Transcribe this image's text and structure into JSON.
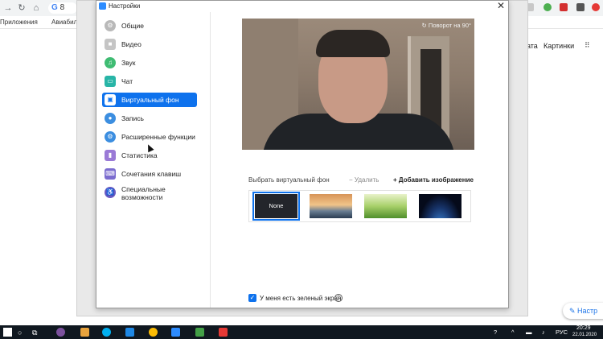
{
  "browser": {
    "address_fragment": "8",
    "bookmarks": [
      "Приложения",
      "Авиабиле"
    ],
    "google_links": [
      "ната",
      "Картинки"
    ],
    "edit_button": "Настр"
  },
  "settings_window": {
    "title": "Настройки",
    "close_label": "✕",
    "nav_items": [
      {
        "label": "Общие",
        "icon": "gear-icon",
        "color": "#b9b9b9"
      },
      {
        "label": "Видео",
        "icon": "video-icon",
        "color": "#c5c5c5"
      },
      {
        "label": "Звук",
        "icon": "headphones-icon",
        "color": "#3fbc73"
      },
      {
        "label": "Чат",
        "icon": "chat-icon",
        "color": "#28b5a7"
      },
      {
        "label": "Виртуальный фон",
        "icon": "virtual-background-icon",
        "color": "#ffffff",
        "active": true
      },
      {
        "label": "Запись",
        "icon": "record-icon",
        "color": "#3c8ee0"
      },
      {
        "label": "Расширенные функции",
        "icon": "advanced-icon",
        "color": "#3c8ee0"
      },
      {
        "label": "Статистика",
        "icon": "statistics-icon",
        "color": "#9a7ad6"
      },
      {
        "label": "Сочетания клавиш",
        "icon": "keyboard-icon",
        "color": "#7b6ccf"
      },
      {
        "label": "Специальные возможности",
        "icon": "accessibility-icon",
        "color": "#6a59c3"
      }
    ],
    "video_preview": {
      "rotate_label": "Поворот на 90°"
    },
    "virtual_background": {
      "title": "Выбрать виртуальный фон",
      "delete_label": "Удалить",
      "add_label": "Добавить изображение",
      "thumbnails": [
        {
          "name": "none",
          "label": "None",
          "selected": true
        },
        {
          "name": "golden-gate"
        },
        {
          "name": "grass"
        },
        {
          "name": "earth-from-space"
        }
      ]
    },
    "green_screen": {
      "label": "У меня есть зеленый экран",
      "checked": true
    }
  },
  "taskbar": {
    "language": "РУС",
    "time": "20:29",
    "date": "22.01.2020"
  }
}
